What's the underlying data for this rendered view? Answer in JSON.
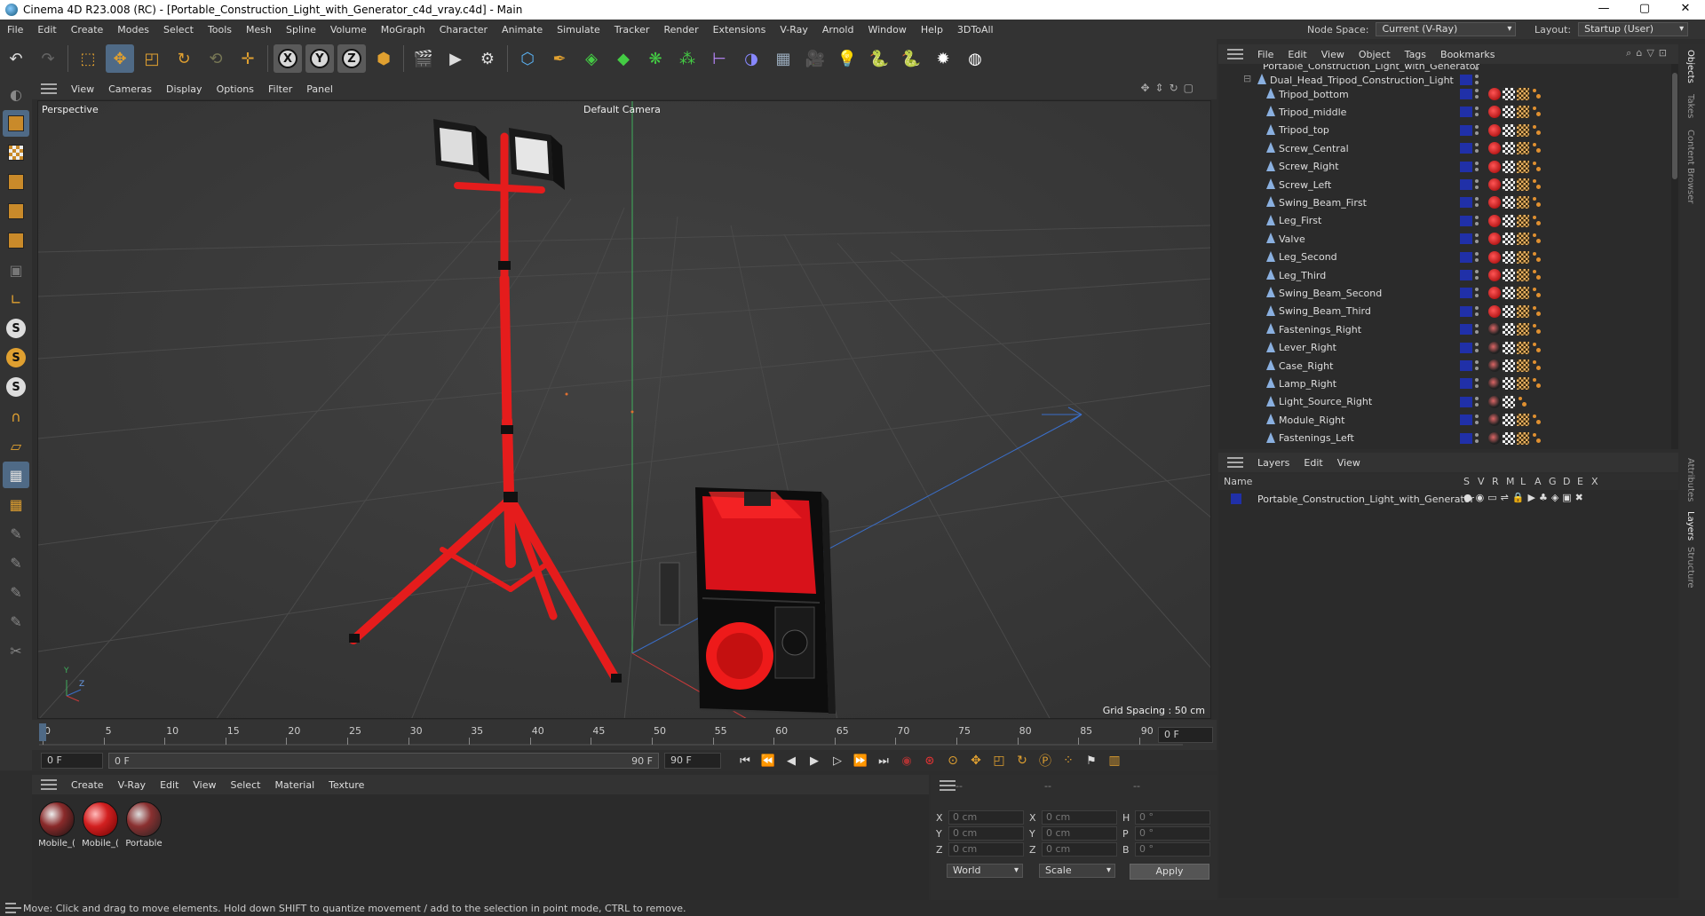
{
  "window": {
    "title": "Cinema 4D R23.008 (RC) - [Portable_Construction_Light_with_Generator_c4d_vray.c4d] - Main",
    "minimize": "—",
    "maximize": "▢",
    "close": "✕"
  },
  "menu": [
    "File",
    "Edit",
    "Create",
    "Modes",
    "Select",
    "Tools",
    "Mesh",
    "Spline",
    "Volume",
    "MoGraph",
    "Character",
    "Animate",
    "Simulate",
    "Tracker",
    "Render",
    "Extensions",
    "V-Ray",
    "Arnold",
    "Window",
    "Help",
    "3DToAll"
  ],
  "node_space": {
    "label": "Node Space:",
    "value": "Current (V-Ray)"
  },
  "layout": {
    "label": "Layout:",
    "value": "Startup (User)"
  },
  "toolbar": {
    "axis_x": "X",
    "axis_y": "Y",
    "axis_z": "Z"
  },
  "viewport_menu": [
    "View",
    "Cameras",
    "Display",
    "Options",
    "Filter",
    "Panel"
  ],
  "viewport": {
    "name": "Perspective",
    "camera": "Default Camera",
    "grid_spacing": "Grid Spacing : 50 cm",
    "axis_y": "Y",
    "axis_z": "Z"
  },
  "timeline": {
    "ticks": [
      "0",
      "5",
      "10",
      "15",
      "20",
      "25",
      "30",
      "35",
      "40",
      "45",
      "50",
      "55",
      "60",
      "65",
      "70",
      "75",
      "80",
      "85",
      "90"
    ],
    "current_frame": "0 F",
    "start_field": "0 F",
    "range_start": "0 F",
    "range_end": "90 F",
    "end_field": "90 F"
  },
  "material_menu": [
    "Create",
    "V-Ray",
    "Edit",
    "View",
    "Select",
    "Material",
    "Texture"
  ],
  "materials": [
    {
      "name": "Mobile_(",
      "color": "#6a2a2a"
    },
    {
      "name": "Mobile_(",
      "color": "#d22020"
    },
    {
      "name": "Portable",
      "color": "#8a3030"
    }
  ],
  "coordinates": {
    "header": [
      "--",
      "--",
      "--"
    ],
    "rows": [
      {
        "a": "X",
        "av": "0 cm",
        "b": "X",
        "bv": "0 cm",
        "c": "H",
        "cv": "0 °"
      },
      {
        "a": "Y",
        "av": "0 cm",
        "b": "Y",
        "bv": "0 cm",
        "c": "P",
        "cv": "0 °"
      },
      {
        "a": "Z",
        "av": "0 cm",
        "b": "Z",
        "bv": "0 cm",
        "c": "B",
        "cv": "0 °"
      }
    ],
    "space": "World",
    "mode": "Scale",
    "apply": "Apply"
  },
  "status": "Move: Click and drag to move elements. Hold down SHIFT to quantize movement / add to the selection in point mode, CTRL to remove.",
  "object_menu": [
    "File",
    "Edit",
    "View",
    "Object",
    "Tags",
    "Bookmarks"
  ],
  "objects": {
    "root": "Portable_Construction_Light_with_Generator",
    "group": "Dual_Head_Tripod_Construction_Light",
    "children": [
      {
        "name": "Tripod_bottom",
        "tag": "red"
      },
      {
        "name": "Tripod_middle",
        "tag": "red"
      },
      {
        "name": "Tripod_top",
        "tag": "red"
      },
      {
        "name": "Screw_Central",
        "tag": "red"
      },
      {
        "name": "Screw_Right",
        "tag": "red"
      },
      {
        "name": "Screw_Left",
        "tag": "red"
      },
      {
        "name": "Swing_Beam_First",
        "tag": "red"
      },
      {
        "name": "Leg_First",
        "tag": "red"
      },
      {
        "name": "Valve",
        "tag": "red"
      },
      {
        "name": "Leg_Second",
        "tag": "red"
      },
      {
        "name": "Leg_Third",
        "tag": "red"
      },
      {
        "name": "Swing_Beam_Second",
        "tag": "red"
      },
      {
        "name": "Swing_Beam_Third",
        "tag": "red"
      },
      {
        "name": "Fastenings_Right",
        "tag": "dark"
      },
      {
        "name": "Lever_Right",
        "tag": "dark"
      },
      {
        "name": "Case_Right",
        "tag": "dark"
      },
      {
        "name": "Lamp_Right",
        "tag": "dark"
      },
      {
        "name": "Light_Source_Right",
        "tag": "dark"
      },
      {
        "name": "Module_Right",
        "tag": "dark"
      },
      {
        "name": "Fastenings_Left",
        "tag": "dark"
      }
    ]
  },
  "layers_menu": [
    "Layers",
    "Edit",
    "View"
  ],
  "layers_header": {
    "name": "Name",
    "cols": [
      "S",
      "V",
      "R",
      "M",
      "L",
      "A",
      "G",
      "D",
      "E",
      "X"
    ]
  },
  "layers": [
    {
      "name": "Portable_Construction_Light_with_Generator"
    }
  ],
  "side_tabs": [
    "Objects",
    "Takes",
    "Content Browser",
    "Attributes",
    "Layers",
    "Structure"
  ]
}
